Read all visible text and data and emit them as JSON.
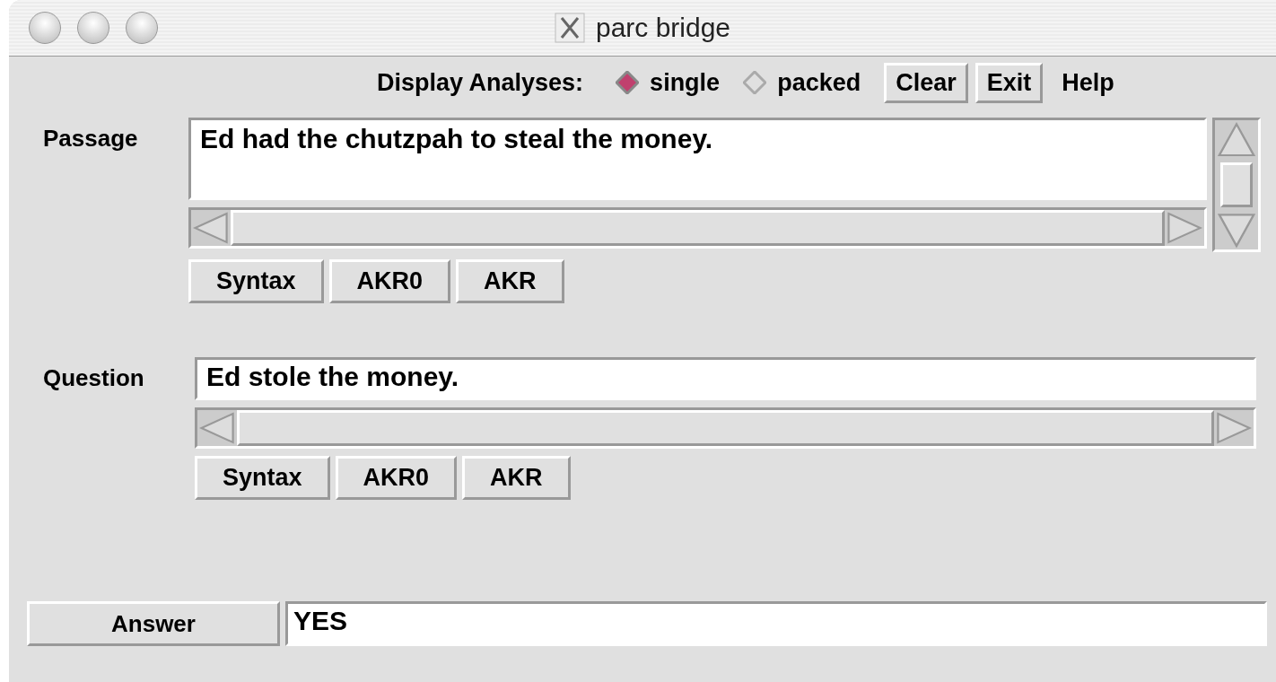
{
  "window": {
    "title": "parc bridge"
  },
  "toolbar": {
    "label": "Display Analyses:",
    "options": [
      {
        "label": "single",
        "selected": true
      },
      {
        "label": "packed",
        "selected": false
      }
    ],
    "buttons": [
      {
        "label": "Clear",
        "raised": true
      },
      {
        "label": "Exit",
        "raised": true
      },
      {
        "label": "Help",
        "raised": false
      }
    ]
  },
  "sections": [
    {
      "label": "Passage",
      "kind": "multiline",
      "value": "Ed had the chutzpah to steal the money.",
      "buttons": [
        "Syntax",
        "AKR0",
        "AKR"
      ]
    },
    {
      "label": "Question",
      "kind": "single",
      "value": "Ed stole the money.",
      "buttons": [
        "Syntax",
        "AKR0",
        "AKR"
      ]
    }
  ],
  "answer": {
    "button": "Answer",
    "value": "YES"
  }
}
